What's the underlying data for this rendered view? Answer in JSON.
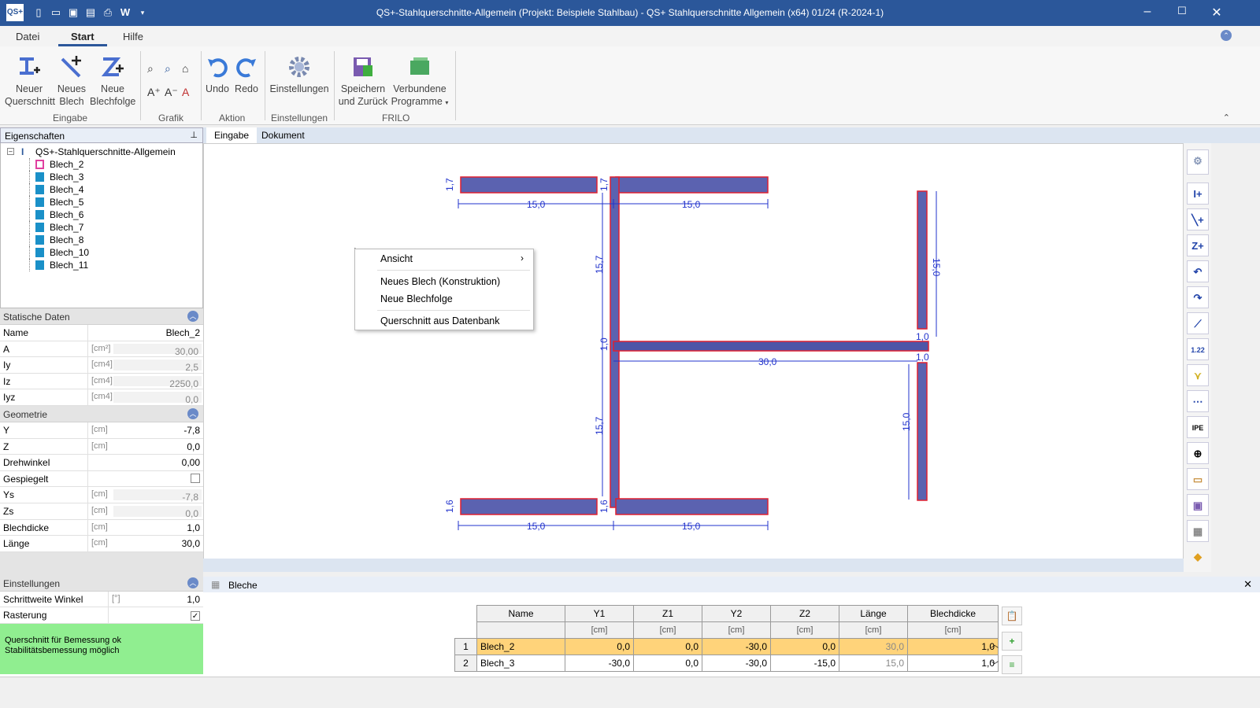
{
  "window": {
    "title": "QS+-Stahlquerschnitte-Allgemein (Projekt: Beispiele Stahlbau) - QS+ Stahlquerschnitte Allgemein (x64) 01/24 (R-2024-1)",
    "app_icon": "QS+"
  },
  "menu_tabs": [
    "Datei",
    "Start",
    "Hilfe"
  ],
  "ribbon": {
    "groups": {
      "eingabe": "Eingabe",
      "grafik": "Grafik",
      "aktion": "Aktion",
      "einstellungen": "Einstellungen",
      "frilo": "FRILO"
    },
    "buttons": {
      "neuer_querschnitt": "Neuer Querschnitt",
      "neues_blech": "Neues Blech",
      "neue_blechfolge": "Neue Blechfolge",
      "undo": "Undo",
      "redo": "Redo",
      "einstellungen": "Einstellungen",
      "speichern": "Speichern und Zurück",
      "verbundene": "Verbundene Programme"
    }
  },
  "left": {
    "properties_title": "Eigenschaften",
    "tree_root": "QS+-Stahlquerschnitte-Allgemein",
    "tree_items": [
      "Blech_2",
      "Blech_3",
      "Blech_4",
      "Blech_5",
      "Blech_6",
      "Blech_7",
      "Blech_8",
      "Blech_10",
      "Blech_11"
    ],
    "statische_daten": {
      "title": "Statische Daten",
      "rows": [
        {
          "label": "Name",
          "unit": "",
          "value": "Blech_2"
        },
        {
          "label": "A",
          "unit": "[cm²]",
          "value": "30,00"
        },
        {
          "label": "Iy",
          "unit": "[cm4]",
          "value": "2,5"
        },
        {
          "label": "Iz",
          "unit": "[cm4]",
          "value": "2250,0"
        },
        {
          "label": "Iyz",
          "unit": "[cm4]",
          "value": "0,0"
        }
      ]
    },
    "geometrie": {
      "title": "Geometrie",
      "rows": [
        {
          "label": "Y",
          "unit": "[cm]",
          "value": "-7,8"
        },
        {
          "label": "Z",
          "unit": "[cm]",
          "value": "0,0"
        },
        {
          "label": "Drehwinkel",
          "unit": "",
          "value": "0,00"
        },
        {
          "label": "Gespiegelt",
          "unit": "",
          "value": ""
        },
        {
          "label": "Ys",
          "unit": "[cm]",
          "value": "-7,8"
        },
        {
          "label": "Zs",
          "unit": "[cm]",
          "value": "0,0"
        },
        {
          "label": "Blechdicke",
          "unit": "[cm]",
          "value": "1,0"
        },
        {
          "label": "Länge",
          "unit": "[cm]",
          "value": "30,0"
        }
      ]
    },
    "einstellungen": {
      "title": "Einstellungen",
      "rows": [
        {
          "label": "Schrittweite Winkel",
          "unit": "[°]",
          "value": "1,0"
        },
        {
          "label": "Rasterung",
          "unit": "",
          "value": ""
        }
      ]
    },
    "status": "Querschnitt für Bemessung ok\nStabilitätsbemessung möglich"
  },
  "main_tabs": [
    "Eingabe",
    "Dokument"
  ],
  "drawing": {
    "dims": {
      "d15": "15,0",
      "d157": "15,7",
      "d17": "1,7",
      "d16": "1,6",
      "d10": "1,0",
      "d30": "30,0"
    }
  },
  "context_menu": {
    "items": [
      "Ansicht",
      "Neues Blech (Konstruktion)",
      "Neue Blechfolge",
      "Querschnitt aus Datenbank"
    ]
  },
  "bottom": {
    "tab_label": "Bleche",
    "columns": [
      "Name",
      "Y1",
      "Z1",
      "Y2",
      "Z2",
      "Länge",
      "Blechdicke"
    ],
    "unit": "[cm]",
    "rows": [
      {
        "idx": "1",
        "name": "Blech_2",
        "y1": "0,0",
        "z1": "0,0",
        "y2": "-30,0",
        "z2": "0,0",
        "len": "30,0",
        "t": "1,0"
      },
      {
        "idx": "2",
        "name": "Blech_3",
        "y1": "-30,0",
        "z1": "0,0",
        "y2": "-30,0",
        "z2": "-15,0",
        "len": "15,0",
        "t": "1,0"
      }
    ]
  },
  "colors": {
    "accent": "#2b579a",
    "plate": "#5b62b0",
    "plate_border": "#e02030",
    "dim": "#2233cc",
    "selected_row": "#ffd37a",
    "status_ok": "#90ee90"
  }
}
